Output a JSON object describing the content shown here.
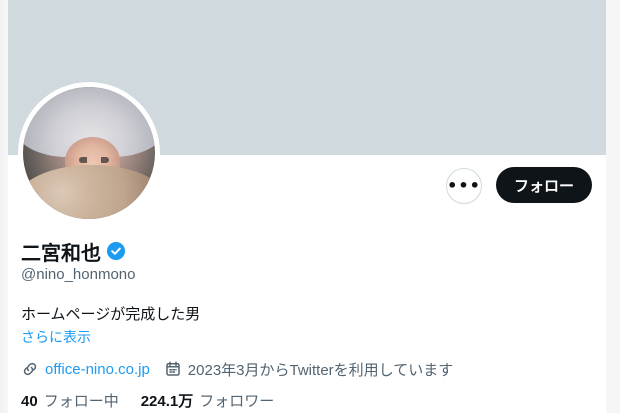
{
  "profile": {
    "display_name": "二宮和也",
    "handle": "@nino_honmono",
    "bio": "ホームページが完成した男",
    "show_more": "さらに表示",
    "verified": true
  },
  "actions": {
    "more_label": "•••",
    "follow_label": "フォロー"
  },
  "meta": {
    "website_text": "office-nino.co.jp",
    "joined_text": "2023年3月からTwitterを利用しています"
  },
  "stats": {
    "following_count": "40",
    "following_label": "フォロー中",
    "followers_count": "224.1万",
    "followers_label": "フォロワー"
  },
  "colors": {
    "banner": "#cfd9de",
    "accent": "#1d9bf0",
    "primary_text": "#0f1419",
    "secondary_text": "#536471",
    "follow_button_bg": "#0f1419"
  },
  "icons": {
    "verified": "verified-badge-icon",
    "more": "more-horizontal-icon",
    "website": "link-icon",
    "joined": "calendar-icon"
  }
}
